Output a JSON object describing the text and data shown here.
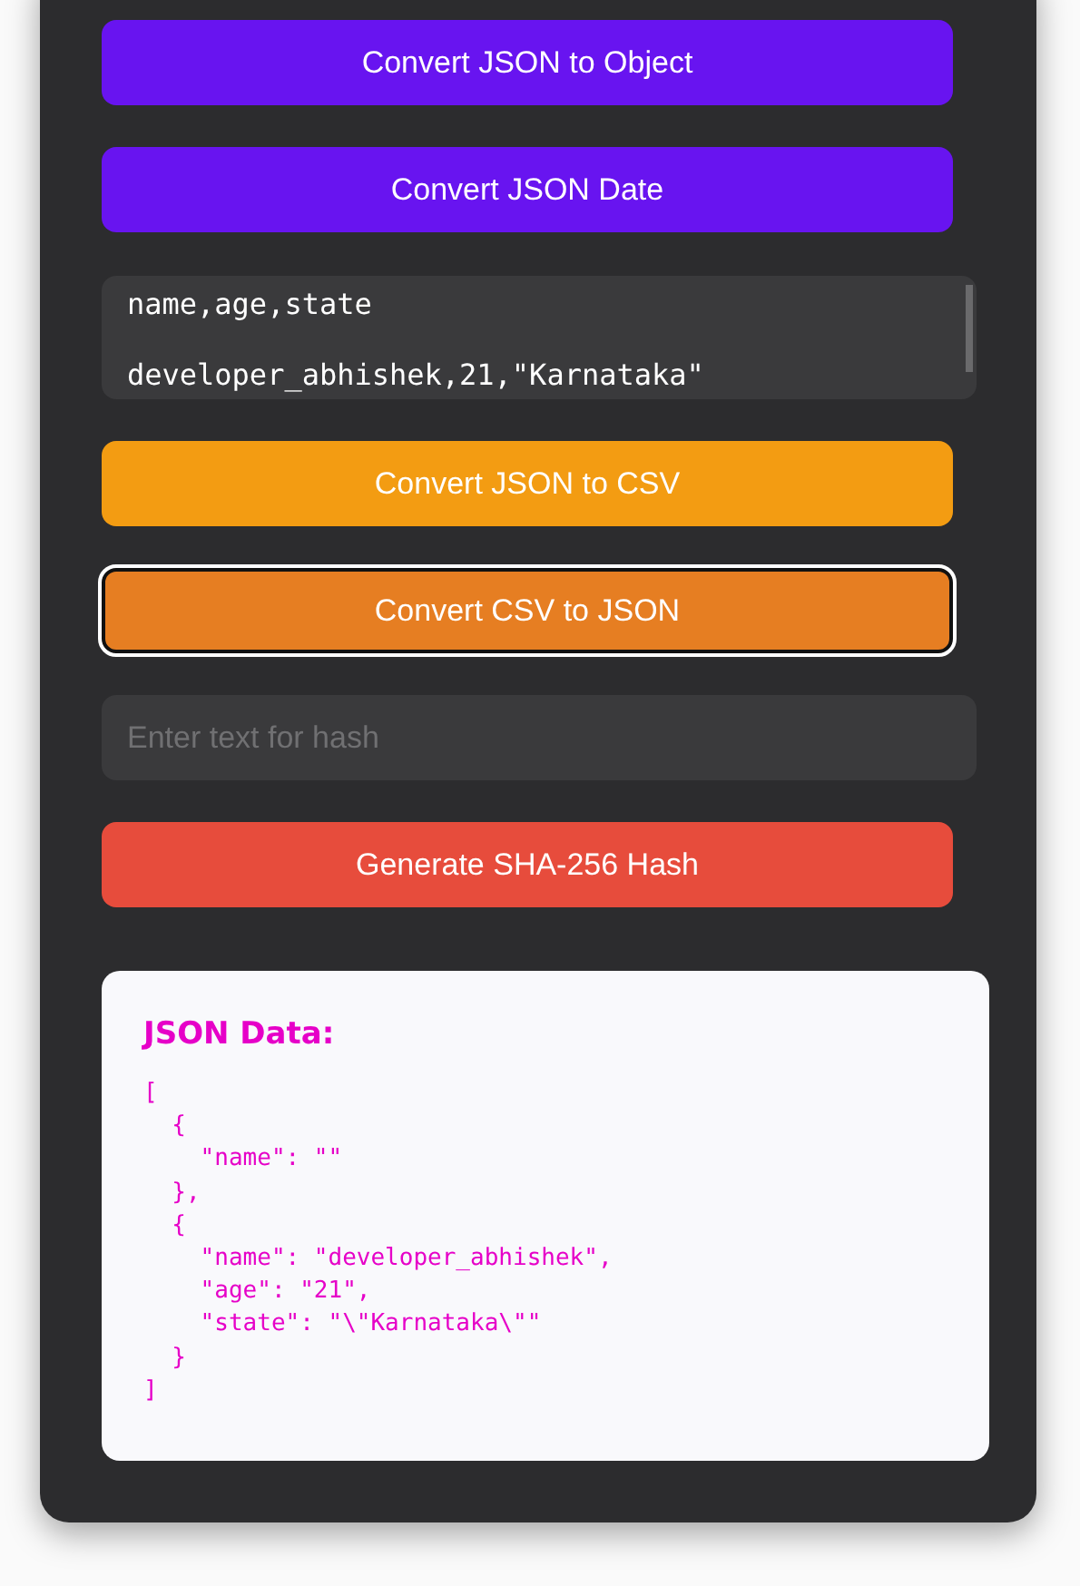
{
  "controls": [
    {
      "kind": "button",
      "label": "Convert JSON to Object",
      "color": "#6814f0",
      "focused": false
    },
    {
      "kind": "button",
      "label": "Convert JSON Date",
      "color": "#6814f0",
      "focused": false
    },
    {
      "kind": "textarea",
      "value": "name,age,state\n\ndeveloper_abhishek,21,\"Karnataka\""
    },
    {
      "kind": "button",
      "label": "Convert JSON to CSV",
      "color": "#f39c12",
      "focused": false
    },
    {
      "kind": "button",
      "label": "Convert CSV to JSON",
      "color": "#e67e22",
      "focused": true
    },
    {
      "kind": "input",
      "placeholder": "Enter text for hash"
    },
    {
      "kind": "button",
      "label": "Generate SHA-256 Hash",
      "color": "#e74c3c",
      "focused": false
    }
  ],
  "output": {
    "title": "JSON Data:",
    "code": "[\n  {\n    \"name\": \"\"\n  },\n  {\n    \"name\": \"developer_abhishek\",\n    \"age\": \"21\",\n    \"state\": \"\\\"Karnataka\\\"\"\n  }\n]"
  }
}
